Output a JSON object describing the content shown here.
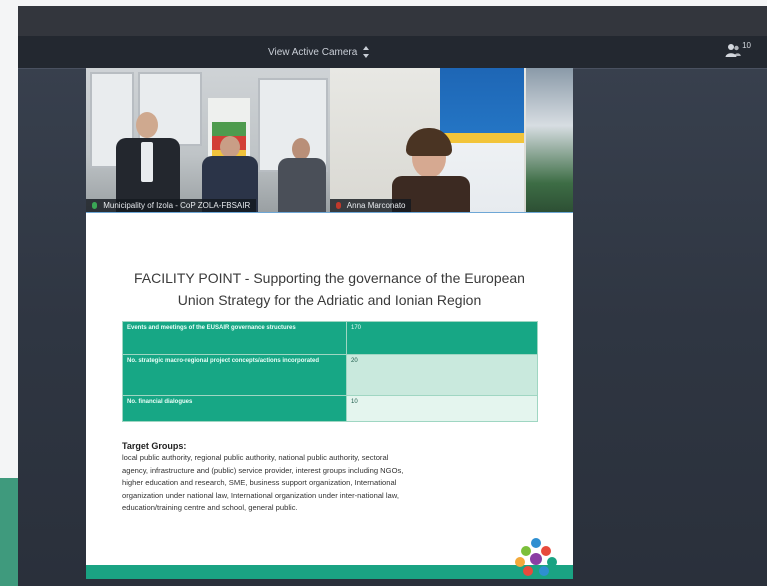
{
  "toolbar": {
    "view_select_label": "View Active Camera",
    "participants_count": "10"
  },
  "video": {
    "tile_a_name": "Municipality of Izola - CoP ZOLA-FBSAIR",
    "tile_b_name": "Anna Marconato"
  },
  "slide": {
    "title_line1": "FACILITY POINT - Supporting the governance of the European",
    "title_line2": "Union  Strategy for the Adriatic and Ionian Region",
    "table": [
      {
        "label": "Events and meetings of the EUSAIR governance structures",
        "value": "170"
      },
      {
        "label": "No. strategic macro-regional project concepts/actions incorporated",
        "value": "20"
      },
      {
        "label": "No. financial dialogues",
        "value": "10"
      }
    ],
    "target_groups_heading": "Target Groups:",
    "target_groups_lines": [
      "local public authority, regional public authority, national public authority, sectoral",
      "agency, infrastructure and (public) service provider, interest groups including NGOs,",
      "higher education and research, SME, business support organization, International",
      "organization under national law, International organization under inter-national law,",
      "education/training centre  and school, general public."
    ]
  },
  "colors": {
    "accent_green": "#17a785",
    "toolbar_bg": "#232830",
    "app_bg": "#2f3642"
  },
  "icons": [
    "updown-chevron-icon",
    "participants-icon",
    "mic-icon",
    "eusair-logo"
  ]
}
